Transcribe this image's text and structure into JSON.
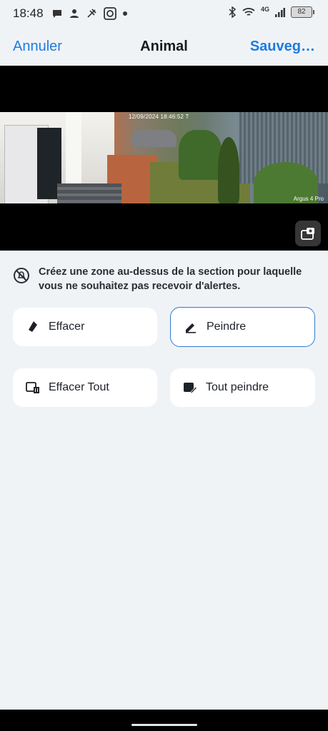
{
  "status_bar": {
    "time": "18:48",
    "network": "4G",
    "battery": "82",
    "icons_left": [
      "chat-icon",
      "person-icon",
      "satellite-icon",
      "app-icon",
      "dot-icon"
    ],
    "icons_right": [
      "bluetooth-icon",
      "wifi-icon",
      "signal-icon",
      "battery-icon"
    ]
  },
  "header": {
    "cancel_label": "Annuler",
    "title": "Animal",
    "save_label": "Sauveg…"
  },
  "video": {
    "timestamp": "12/09/2024 18:46:52 T",
    "camera_model": "Argus 4 Pro",
    "snapshot_icon": "camera-switch-icon"
  },
  "info": {
    "text": "Créez une zone au-dessus de la section pour laquelle vous ne souhaitez pas recevoir d'alertes.",
    "icon": "no-alert-icon"
  },
  "actions": {
    "erase": {
      "label": "Effacer",
      "icon": "eraser-icon"
    },
    "paint": {
      "label": "Peindre",
      "icon": "pencil-icon",
      "selected": true
    },
    "erase_all": {
      "label": "Effacer Tout",
      "icon": "clear-all-icon"
    },
    "paint_all": {
      "label": "Tout peindre",
      "icon": "paint-all-icon"
    }
  },
  "colors": {
    "accent": "#1e7be0",
    "background": "#f0f3f6",
    "selected_border": "#2f7ad6"
  }
}
